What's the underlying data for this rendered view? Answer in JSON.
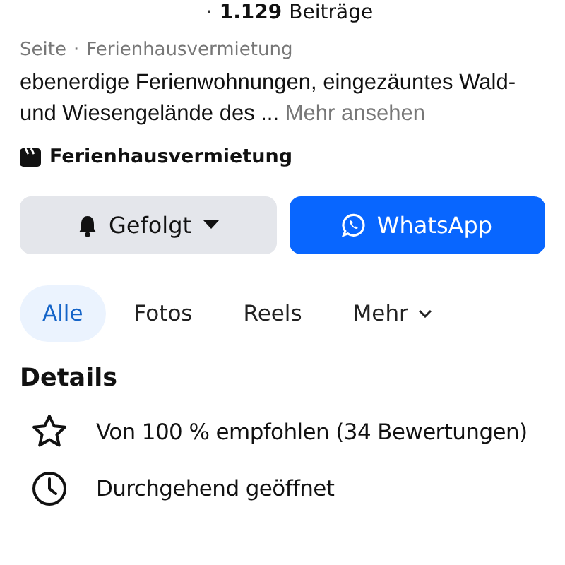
{
  "header": {
    "separator": "·",
    "count": "1.129",
    "count_label": "Beiträge"
  },
  "meta": {
    "type": "Seite",
    "separator": "·",
    "category": "Ferienhausvermietung"
  },
  "description": {
    "text": "ebenerdige Ferienwohnungen, eingezäuntes Wald- und Wiesengelände des ...",
    "more": "Mehr ansehen"
  },
  "category_tag": {
    "label": "Ferienhausvermietung"
  },
  "buttons": [
    {
      "kind": "follow",
      "label": "Gefolgt"
    },
    {
      "kind": "whatsapp",
      "label": "WhatsApp"
    }
  ],
  "tabs": [
    {
      "label": "Alle",
      "selected": true,
      "dropdown": false
    },
    {
      "label": "Fotos",
      "selected": false,
      "dropdown": false
    },
    {
      "label": "Reels",
      "selected": false,
      "dropdown": false
    },
    {
      "label": "Mehr",
      "selected": false,
      "dropdown": true
    }
  ],
  "details": {
    "title": "Details",
    "items": [
      {
        "kind": "rating",
        "text": "Von 100 % empfohlen (34 Bewertungen)"
      },
      {
        "kind": "hours",
        "text": "Durchgehend geöffnet"
      }
    ]
  }
}
